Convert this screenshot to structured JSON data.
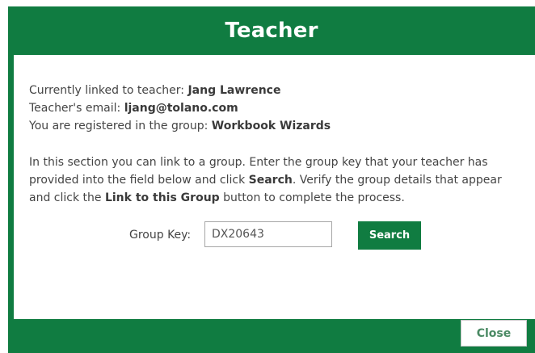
{
  "dialog": {
    "title": "Teacher",
    "close_label": "Close"
  },
  "info": {
    "teacher_prefix": "Currently linked to teacher: ",
    "teacher_name": "Jang Lawrence",
    "email_prefix": "Teacher's email: ",
    "email": "ljang@tolano.com",
    "group_prefix": "You are registered in the group: ",
    "group_name": "Workbook Wizards"
  },
  "instructions": {
    "part1": "In this section you can link to a group. Enter the group key that your teacher has provided into the field below and click ",
    "search_word": "Search",
    "part2": ". Verify the group details that appear and click the ",
    "link_word": "Link to this Group",
    "part3": " button to complete the process."
  },
  "group_key": {
    "label": "Group Key:",
    "value": "DX20643",
    "search_label": "Search"
  },
  "colors": {
    "accent": "#107c41"
  }
}
